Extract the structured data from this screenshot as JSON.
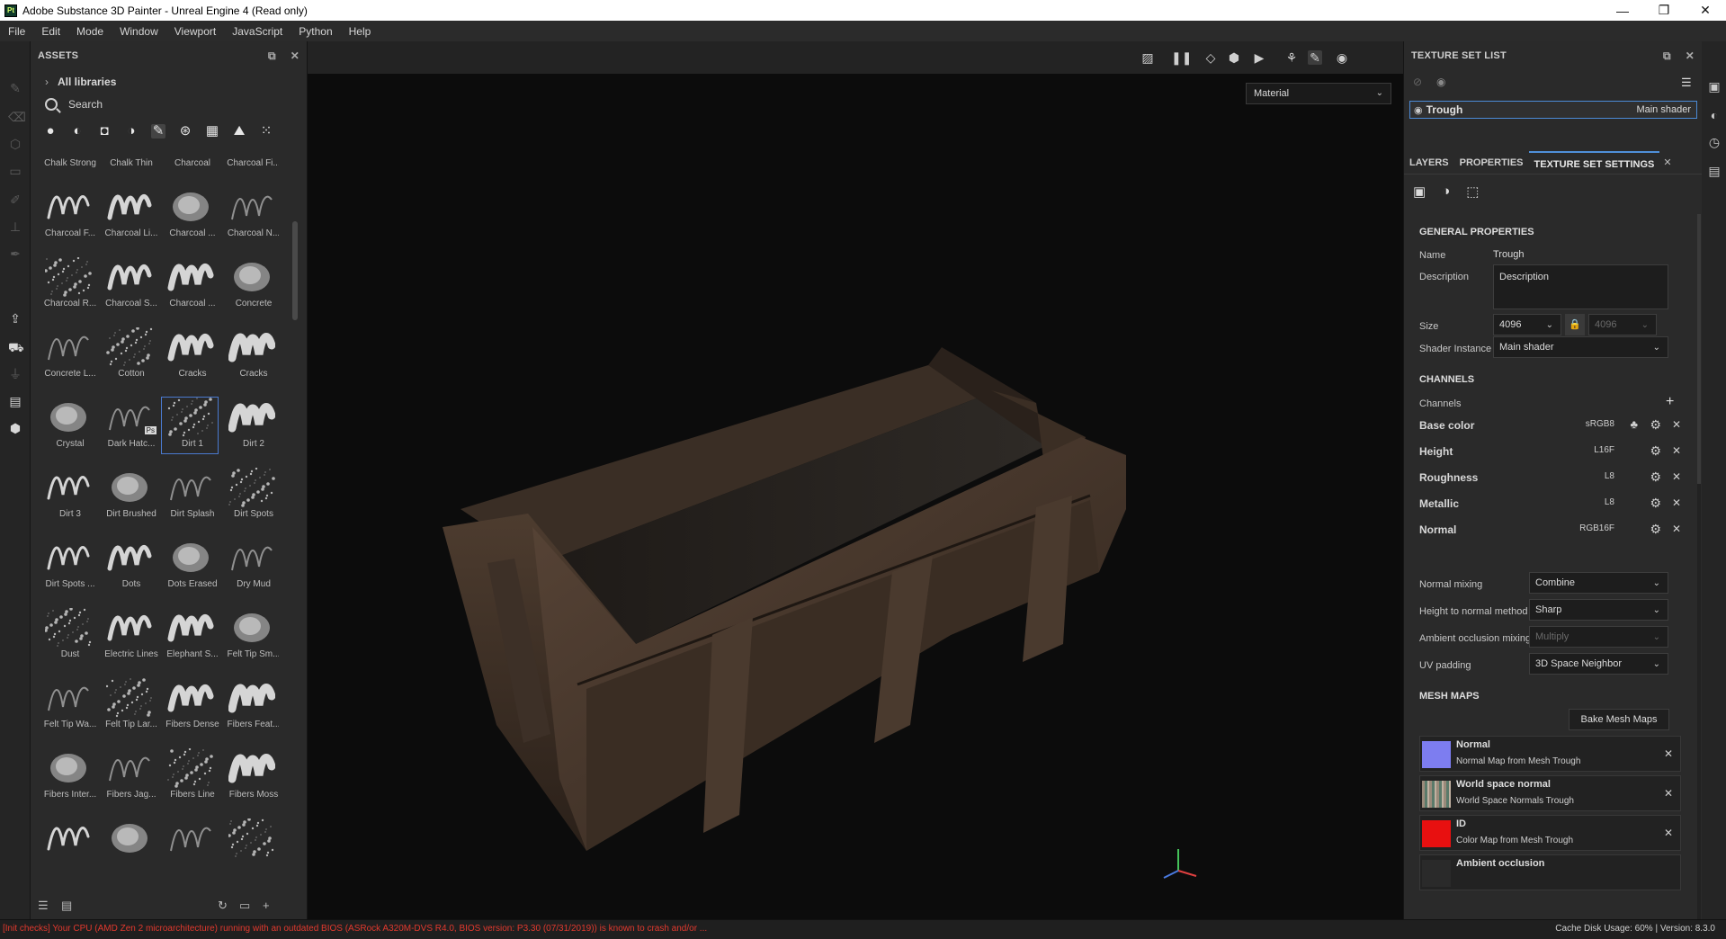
{
  "window": {
    "title": "Adobe Substance 3D Painter - Unreal Engine 4 (Read only)",
    "app_icon_text": "Pt",
    "controls": [
      "—",
      "❐",
      "✕"
    ]
  },
  "menu": [
    "File",
    "Edit",
    "Mode",
    "Window",
    "Viewport",
    "JavaScript",
    "Python",
    "Help"
  ],
  "assets": {
    "title": "ASSETS",
    "breadcrumb": "All libraries",
    "search_placeholder": "Search",
    "filters": [
      "materials",
      "smart-materials",
      "alphas",
      "procedurals",
      "brushes",
      "particles",
      "textures",
      "environments",
      "grid"
    ],
    "items": [
      {
        "label": "Chalk Strong"
      },
      {
        "label": "Chalk Thin"
      },
      {
        "label": "Charcoal"
      },
      {
        "label": "Charcoal Fi..."
      },
      {
        "label": "Charcoal F..."
      },
      {
        "label": "Charcoal Li..."
      },
      {
        "label": "Charcoal ..."
      },
      {
        "label": "Charcoal N..."
      },
      {
        "label": "Charcoal R..."
      },
      {
        "label": "Charcoal S..."
      },
      {
        "label": "Charcoal ..."
      },
      {
        "label": "Concrete"
      },
      {
        "label": "Concrete L..."
      },
      {
        "label": "Cotton"
      },
      {
        "label": "Cracks"
      },
      {
        "label": "Cracks"
      },
      {
        "label": "Crystal"
      },
      {
        "label": "Dark Hatc..."
      },
      {
        "label": "Dirt 1"
      },
      {
        "label": "Dirt 2"
      },
      {
        "label": "Dirt 3"
      },
      {
        "label": "Dirt Brushed"
      },
      {
        "label": "Dirt Splash"
      },
      {
        "label": "Dirt Spots"
      },
      {
        "label": "Dirt Spots ..."
      },
      {
        "label": "Dots"
      },
      {
        "label": "Dots Erased"
      },
      {
        "label": "Dry Mud"
      },
      {
        "label": "Dust"
      },
      {
        "label": "Electric Lines"
      },
      {
        "label": "Elephant S..."
      },
      {
        "label": "Felt Tip Sm..."
      },
      {
        "label": "Felt Tip Wa..."
      },
      {
        "label": "Felt Tip Lar..."
      },
      {
        "label": "Fibers Dense"
      },
      {
        "label": "Fibers Feat..."
      },
      {
        "label": "Fibers Inter..."
      },
      {
        "label": "Fibers Jag..."
      },
      {
        "label": "Fibers Line"
      },
      {
        "label": "Fibers Moss"
      },
      {
        "label": ""
      },
      {
        "label": ""
      },
      {
        "label": ""
      },
      {
        "label": ""
      }
    ],
    "selected_label": "Dirt 1",
    "ps_badge": "Ps"
  },
  "viewport": {
    "material_mode": "Material"
  },
  "texture_set_list": {
    "title": "TEXTURE SET LIST",
    "set_name": "Trough",
    "shader": "Main shader"
  },
  "tabs": {
    "layers": "LAYERS",
    "properties": "PROPERTIES",
    "settings": "TEXTURE SET SETTINGS",
    "close": "✕"
  },
  "general": {
    "title": "GENERAL PROPERTIES",
    "name_label": "Name",
    "name_value": "Trough",
    "description_label": "Description",
    "description_value": "Description",
    "size_label": "Size",
    "size_value": "4096",
    "size_value_locked": "4096",
    "shader_label": "Shader Instance",
    "shader_value": "Main shader"
  },
  "channels": {
    "title": "CHANNELS",
    "add_label": "Channels",
    "list": [
      {
        "name": "Base color",
        "format": "sRGB8"
      },
      {
        "name": "Height",
        "format": "L16F"
      },
      {
        "name": "Roughness",
        "format": "L8"
      },
      {
        "name": "Metallic",
        "format": "L8"
      },
      {
        "name": "Normal",
        "format": "RGB16F"
      }
    ]
  },
  "mixing": {
    "normal_mixing_label": "Normal mixing",
    "normal_mixing_value": "Combine",
    "height_to_normal_label": "Height to normal method",
    "height_to_normal_value": "Sharp",
    "ao_mixing_label": "Ambient occlusion mixing",
    "ao_mixing_value": "Multiply",
    "uv_padding_label": "UV padding",
    "uv_padding_value": "3D Space Neighbor"
  },
  "mesh_maps": {
    "title": "MESH MAPS",
    "bake_button": "Bake Mesh Maps",
    "list": [
      {
        "name": "Normal",
        "desc": "Normal Map from Mesh Trough",
        "color": "#7d7df0"
      },
      {
        "name": "World space normal",
        "desc": "World Space Normals Trough",
        "color": "#8a9a7a"
      },
      {
        "name": "ID",
        "desc": "Color Map from Mesh Trough",
        "color": "#e81010"
      },
      {
        "name": "Ambient occlusion",
        "desc": "",
        "color": "#222222"
      }
    ]
  },
  "status": {
    "message": "[Init checks] Your CPU (AMD Zen 2 microarchitecture) running with an outdated BIOS (ASRock A320M-DVS R4.0, BIOS version: P3.30 (07/31/2019)) is known to crash and/or ...",
    "right": "Cache Disk Usage:   60% | Version: 8.3.0"
  },
  "colors": {
    "accent": "#4f8fd8",
    "error_text": "#e1392e"
  }
}
